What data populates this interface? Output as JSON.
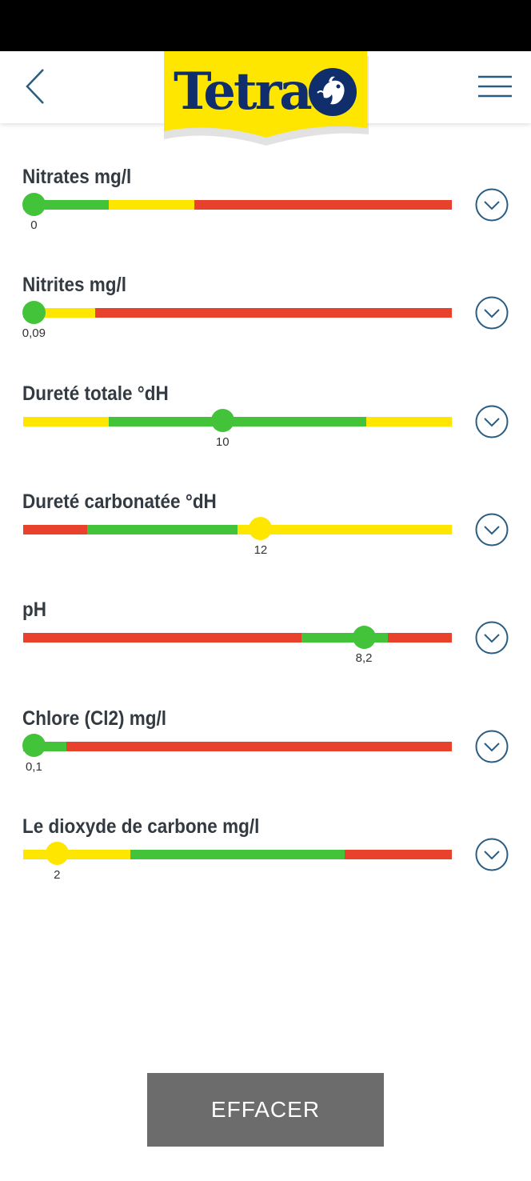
{
  "header": {
    "logo_text": "Tetra",
    "back_icon": "chevron-left-icon",
    "menu_icon": "hamburger-menu-icon"
  },
  "colors": {
    "green": "#43c33a",
    "yellow": "#ffe600",
    "red": "#e8412c",
    "accent": "#2a5d82",
    "logo_yellow": "#ffe600",
    "logo_blue": "#0f2e6b",
    "button_gray": "#6c6c6c"
  },
  "params": [
    {
      "title": "Nitrates mg/l",
      "value": "0",
      "thumb_position": 0.025,
      "thumb_color": "green",
      "segments": [
        {
          "color": "green",
          "from": 0.0,
          "to": 0.2
        },
        {
          "color": "yellow",
          "from": 0.2,
          "to": 0.4
        },
        {
          "color": "red",
          "from": 0.4,
          "to": 1.0
        }
      ]
    },
    {
      "title": "Nitrites mg/l",
      "value": "0,09",
      "thumb_position": 0.025,
      "thumb_color": "green",
      "segments": [
        {
          "color": "green",
          "from": 0.0,
          "to": 0.035
        },
        {
          "color": "yellow",
          "from": 0.035,
          "to": 0.167
        },
        {
          "color": "red",
          "from": 0.167,
          "to": 1.0
        }
      ]
    },
    {
      "title": "Dureté totale °dH",
      "value": "10",
      "thumb_position": 0.465,
      "thumb_color": "green",
      "segments": [
        {
          "color": "yellow",
          "from": 0.0,
          "to": 0.2
        },
        {
          "color": "green",
          "from": 0.2,
          "to": 0.8
        },
        {
          "color": "yellow",
          "from": 0.8,
          "to": 1.0
        }
      ]
    },
    {
      "title": "Dureté carbonatée °dH",
      "value": "12",
      "thumb_position": 0.554,
      "thumb_color": "yellow",
      "segments": [
        {
          "color": "red",
          "from": 0.0,
          "to": 0.149
        },
        {
          "color": "green",
          "from": 0.149,
          "to": 0.5
        },
        {
          "color": "yellow",
          "from": 0.5,
          "to": 1.0
        }
      ]
    },
    {
      "title": "pH",
      "value": "8,2",
      "thumb_position": 0.795,
      "thumb_color": "green",
      "segments": [
        {
          "color": "red",
          "from": 0.0,
          "to": 0.649
        },
        {
          "color": "green",
          "from": 0.649,
          "to": 0.85
        },
        {
          "color": "red",
          "from": 0.85,
          "to": 1.0
        }
      ]
    },
    {
      "title": "Chlore (Cl2) mg/l",
      "value": "0,1",
      "thumb_position": 0.025,
      "thumb_color": "green",
      "segments": [
        {
          "color": "green",
          "from": 0.0,
          "to": 0.1
        },
        {
          "color": "red",
          "from": 0.1,
          "to": 1.0
        }
      ]
    },
    {
      "title": "Le dioxyde de carbone mg/l",
      "value": "2",
      "thumb_position": 0.079,
      "thumb_color": "yellow",
      "segments": [
        {
          "color": "yellow",
          "from": 0.0,
          "to": 0.25
        },
        {
          "color": "green",
          "from": 0.25,
          "to": 0.75
        },
        {
          "color": "red",
          "from": 0.75,
          "to": 1.0
        }
      ]
    }
  ],
  "expand_icon": "chevron-down-circle-icon",
  "clear_button": {
    "label": "EFFACER"
  }
}
